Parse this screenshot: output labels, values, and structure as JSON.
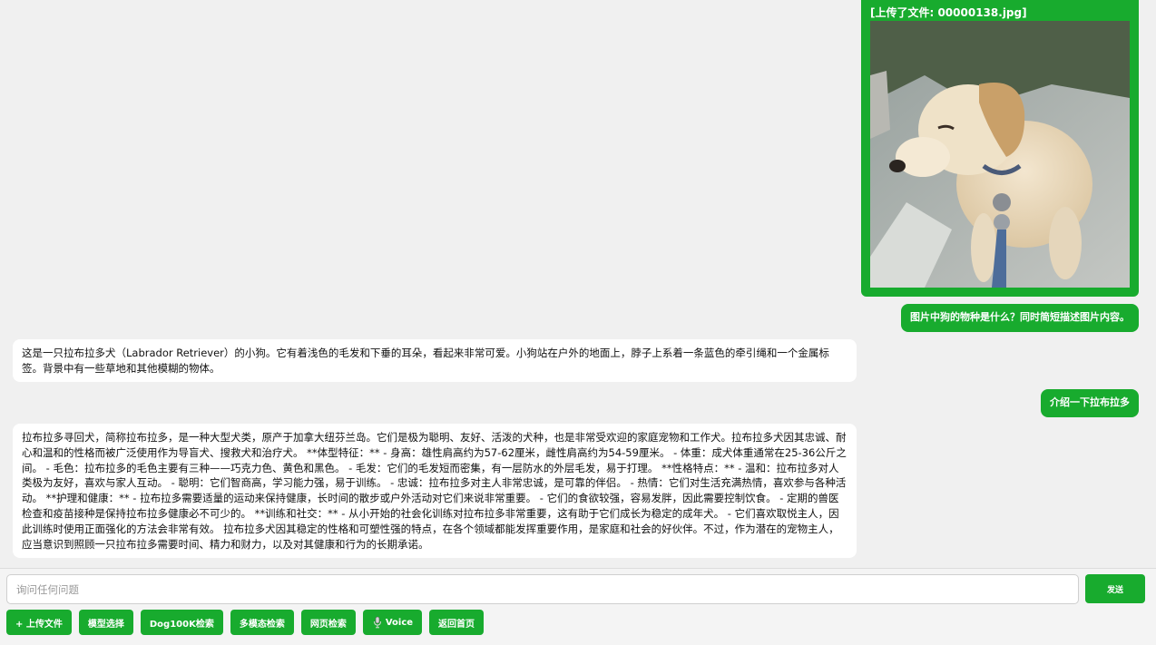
{
  "messages": {
    "upload_caption": "[上传了文件: 00000138.jpg]",
    "user_q1": "图片中狗的物种是什么？同时简短描述图片内容。",
    "bot_a1": "这是一只拉布拉多犬（Labrador Retriever）的小狗。它有着浅色的毛发和下垂的耳朵，看起来非常可爱。小狗站在户外的地面上，脖子上系着一条蓝色的牵引绳和一个金属标签。背景中有一些草地和其他模糊的物体。",
    "user_q2": "介绍一下拉布拉多",
    "bot_a2": "拉布拉多寻回犬，简称拉布拉多，是一种大型犬类，原产于加拿大纽芬兰岛。它们是极为聪明、友好、活泼的犬种，也是非常受欢迎的家庭宠物和工作犬。拉布拉多犬因其忠诚、耐心和温和的性格而被广泛使用作为导盲犬、搜救犬和治疗犬。 **体型特征：** - 身高：雄性肩高约为57-62厘米，雌性肩高约为54-59厘米。 - 体重：成犬体重通常在25-36公斤之间。 - 毛色：拉布拉多的毛色主要有三种——巧克力色、黄色和黑色。 - 毛发：它们的毛发短而密集，有一层防水的外层毛发，易于打理。 **性格特点：** - 温和：拉布拉多对人类极为友好，喜欢与家人互动。 - 聪明：它们智商高，学习能力强，易于训练。 - 忠诚：拉布拉多对主人非常忠诚，是可靠的伴侣。 - 热情：它们对生活充满热情，喜欢参与各种活动。 **护理和健康：** - 拉布拉多需要适量的运动来保持健康，长时间的散步或户外活动对它们来说非常重要。 - 它们的食欲较强，容易发胖，因此需要控制饮食。 - 定期的兽医检查和疫苗接种是保持拉布拉多健康必不可少的。 **训练和社交：** - 从小开始的社会化训练对拉布拉多非常重要，这有助于它们成长为稳定的成年犬。 - 它们喜欢取悦主人，因此训练时使用正面强化的方法会非常有效。 拉布拉多犬因其稳定的性格和可塑性强的特点，在各个领域都能发挥重要作用，是家庭和社会的好伙伴。不过，作为潜在的宠物主人，应当意识到照顾一只拉布拉多需要时间、精力和财力，以及对其健康和行为的长期承诺。"
  },
  "input": {
    "placeholder": "询问任何问题",
    "value": ""
  },
  "send_label": "发送",
  "toolbar": {
    "upload": "+ 上传文件",
    "model_select": "模型选择",
    "dog_search": "Dog100K检索",
    "multimodal_search": "多模态检索",
    "web_search": "网页检索",
    "voice": "Voice",
    "home": "返回首页"
  },
  "colors": {
    "accent": "#18ab2e",
    "background": "#f0f0f0",
    "bot_bubble": "#ffffff"
  },
  "icons": {
    "voice": "microphone-icon"
  }
}
